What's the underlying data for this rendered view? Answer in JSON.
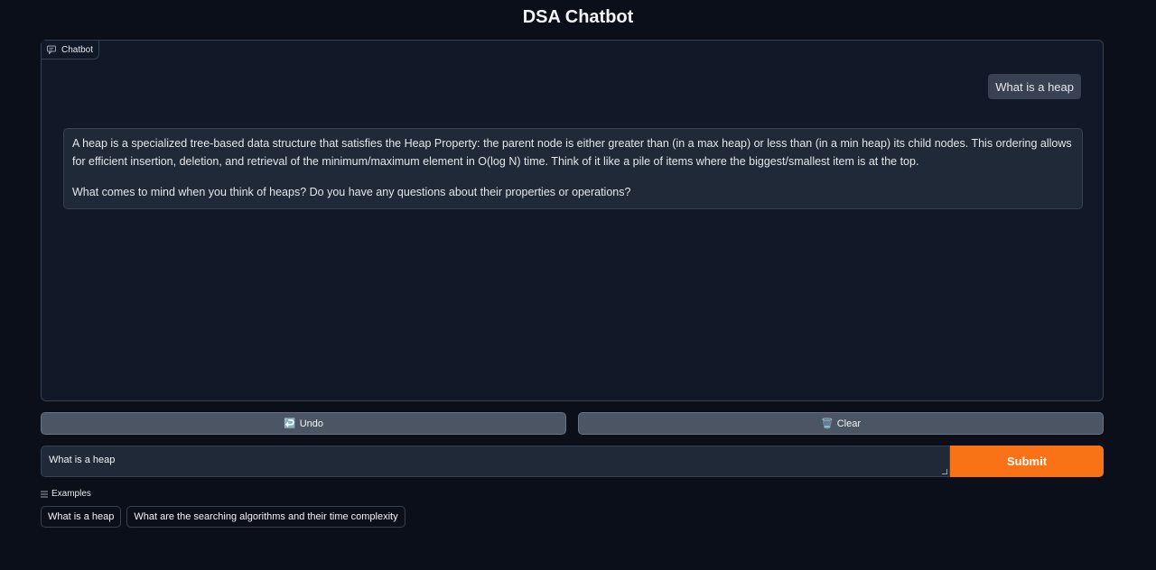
{
  "app": {
    "title": "DSA Chatbot"
  },
  "chatbot": {
    "label": "Chatbot",
    "label_icon": "chat-bubble-icon",
    "messages": [
      {
        "role": "user",
        "text": "What is a heap"
      },
      {
        "role": "assistant",
        "paragraphs": [
          "A heap is a specialized tree-based data structure that satisfies the Heap Property: the parent node is either greater than (in a max heap) or less than (in a min heap) its child nodes. This ordering allows for efficient insertion, deletion, and retrieval of the minimum/maximum element in O(log N) time. Think of it like a pile of items where the biggest/smallest item is at the top.",
          "What comes to mind when you think of heaps? Do you have any questions about their properties or operations?"
        ]
      }
    ]
  },
  "actions": {
    "undo": {
      "label": "Undo",
      "icon": "↩️"
    },
    "clear": {
      "label": "Clear",
      "icon": "🗑️"
    }
  },
  "input": {
    "value": "What is a heap",
    "submit_label": "Submit"
  },
  "examples": {
    "label": "Examples",
    "label_icon": "list-icon",
    "items": [
      "What is a heap",
      "What are the searching algorithms and their time complexity"
    ]
  },
  "colors": {
    "accent": "#f97316",
    "background": "#0b0f19",
    "panel": "#111827"
  }
}
